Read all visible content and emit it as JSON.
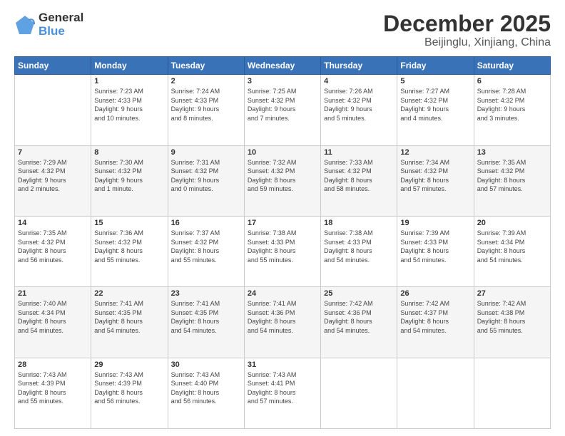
{
  "logo": {
    "general": "General",
    "blue": "Blue"
  },
  "title": "December 2025",
  "subtitle": "Beijinglu, Xinjiang, China",
  "headers": [
    "Sunday",
    "Monday",
    "Tuesday",
    "Wednesday",
    "Thursday",
    "Friday",
    "Saturday"
  ],
  "weeks": [
    [
      {
        "day": "",
        "info": ""
      },
      {
        "day": "1",
        "info": "Sunrise: 7:23 AM\nSunset: 4:33 PM\nDaylight: 9 hours\nand 10 minutes."
      },
      {
        "day": "2",
        "info": "Sunrise: 7:24 AM\nSunset: 4:33 PM\nDaylight: 9 hours\nand 8 minutes."
      },
      {
        "day": "3",
        "info": "Sunrise: 7:25 AM\nSunset: 4:32 PM\nDaylight: 9 hours\nand 7 minutes."
      },
      {
        "day": "4",
        "info": "Sunrise: 7:26 AM\nSunset: 4:32 PM\nDaylight: 9 hours\nand 5 minutes."
      },
      {
        "day": "5",
        "info": "Sunrise: 7:27 AM\nSunset: 4:32 PM\nDaylight: 9 hours\nand 4 minutes."
      },
      {
        "day": "6",
        "info": "Sunrise: 7:28 AM\nSunset: 4:32 PM\nDaylight: 9 hours\nand 3 minutes."
      }
    ],
    [
      {
        "day": "7",
        "info": "Sunrise: 7:29 AM\nSunset: 4:32 PM\nDaylight: 9 hours\nand 2 minutes."
      },
      {
        "day": "8",
        "info": "Sunrise: 7:30 AM\nSunset: 4:32 PM\nDaylight: 9 hours\nand 1 minute."
      },
      {
        "day": "9",
        "info": "Sunrise: 7:31 AM\nSunset: 4:32 PM\nDaylight: 9 hours\nand 0 minutes."
      },
      {
        "day": "10",
        "info": "Sunrise: 7:32 AM\nSunset: 4:32 PM\nDaylight: 8 hours\nand 59 minutes."
      },
      {
        "day": "11",
        "info": "Sunrise: 7:33 AM\nSunset: 4:32 PM\nDaylight: 8 hours\nand 58 minutes."
      },
      {
        "day": "12",
        "info": "Sunrise: 7:34 AM\nSunset: 4:32 PM\nDaylight: 8 hours\nand 57 minutes."
      },
      {
        "day": "13",
        "info": "Sunrise: 7:35 AM\nSunset: 4:32 PM\nDaylight: 8 hours\nand 57 minutes."
      }
    ],
    [
      {
        "day": "14",
        "info": "Sunrise: 7:35 AM\nSunset: 4:32 PM\nDaylight: 8 hours\nand 56 minutes."
      },
      {
        "day": "15",
        "info": "Sunrise: 7:36 AM\nSunset: 4:32 PM\nDaylight: 8 hours\nand 55 minutes."
      },
      {
        "day": "16",
        "info": "Sunrise: 7:37 AM\nSunset: 4:32 PM\nDaylight: 8 hours\nand 55 minutes."
      },
      {
        "day": "17",
        "info": "Sunrise: 7:38 AM\nSunset: 4:33 PM\nDaylight: 8 hours\nand 55 minutes."
      },
      {
        "day": "18",
        "info": "Sunrise: 7:38 AM\nSunset: 4:33 PM\nDaylight: 8 hours\nand 54 minutes."
      },
      {
        "day": "19",
        "info": "Sunrise: 7:39 AM\nSunset: 4:33 PM\nDaylight: 8 hours\nand 54 minutes."
      },
      {
        "day": "20",
        "info": "Sunrise: 7:39 AM\nSunset: 4:34 PM\nDaylight: 8 hours\nand 54 minutes."
      }
    ],
    [
      {
        "day": "21",
        "info": "Sunrise: 7:40 AM\nSunset: 4:34 PM\nDaylight: 8 hours\nand 54 minutes."
      },
      {
        "day": "22",
        "info": "Sunrise: 7:41 AM\nSunset: 4:35 PM\nDaylight: 8 hours\nand 54 minutes."
      },
      {
        "day": "23",
        "info": "Sunrise: 7:41 AM\nSunset: 4:35 PM\nDaylight: 8 hours\nand 54 minutes."
      },
      {
        "day": "24",
        "info": "Sunrise: 7:41 AM\nSunset: 4:36 PM\nDaylight: 8 hours\nand 54 minutes."
      },
      {
        "day": "25",
        "info": "Sunrise: 7:42 AM\nSunset: 4:36 PM\nDaylight: 8 hours\nand 54 minutes."
      },
      {
        "day": "26",
        "info": "Sunrise: 7:42 AM\nSunset: 4:37 PM\nDaylight: 8 hours\nand 54 minutes."
      },
      {
        "day": "27",
        "info": "Sunrise: 7:42 AM\nSunset: 4:38 PM\nDaylight: 8 hours\nand 55 minutes."
      }
    ],
    [
      {
        "day": "28",
        "info": "Sunrise: 7:43 AM\nSunset: 4:39 PM\nDaylight: 8 hours\nand 55 minutes."
      },
      {
        "day": "29",
        "info": "Sunrise: 7:43 AM\nSunset: 4:39 PM\nDaylight: 8 hours\nand 56 minutes."
      },
      {
        "day": "30",
        "info": "Sunrise: 7:43 AM\nSunset: 4:40 PM\nDaylight: 8 hours\nand 56 minutes."
      },
      {
        "day": "31",
        "info": "Sunrise: 7:43 AM\nSunset: 4:41 PM\nDaylight: 8 hours\nand 57 minutes."
      },
      {
        "day": "",
        "info": ""
      },
      {
        "day": "",
        "info": ""
      },
      {
        "day": "",
        "info": ""
      }
    ]
  ]
}
